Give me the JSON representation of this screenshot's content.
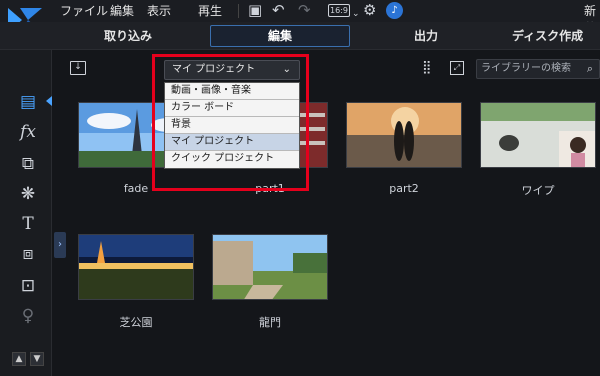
{
  "menubar": {
    "items": [
      "ファイル",
      "編集",
      "表示",
      "再生"
    ],
    "aspect": "16:9",
    "right_label": "新共"
  },
  "mode_tabs": [
    "取り込み",
    "編集",
    "出力",
    "ディスク作成"
  ],
  "library": {
    "dropdown": {
      "selected": "マイ プロジェクト",
      "options": [
        "動画・画像・音楽",
        "カラー ボード",
        "背景",
        "マイ プロジェクト",
        "クイック プロジェクト"
      ]
    },
    "search_placeholder": "ライブラリーの検索",
    "items": [
      {
        "label": "fade"
      },
      {
        "label": "part1"
      },
      {
        "label": "part2"
      },
      {
        "label": "ワイプ"
      },
      {
        "label": "芝公園"
      },
      {
        "label": "龍門"
      }
    ]
  },
  "colors": {
    "accent": "#4aa3ff",
    "highlight_border": "#e5001c",
    "background": "#14161a"
  },
  "icons": [
    "logo-icon",
    "save-icon",
    "undo-icon",
    "redo-icon",
    "settings-icon",
    "notification-icon",
    "media-icon",
    "fx-icon",
    "transition-icon",
    "particle-icon",
    "title-icon",
    "pip-icon",
    "subtitle-icon",
    "mic-icon",
    "import-icon",
    "grid-icon",
    "expand-icon",
    "search-icon"
  ]
}
